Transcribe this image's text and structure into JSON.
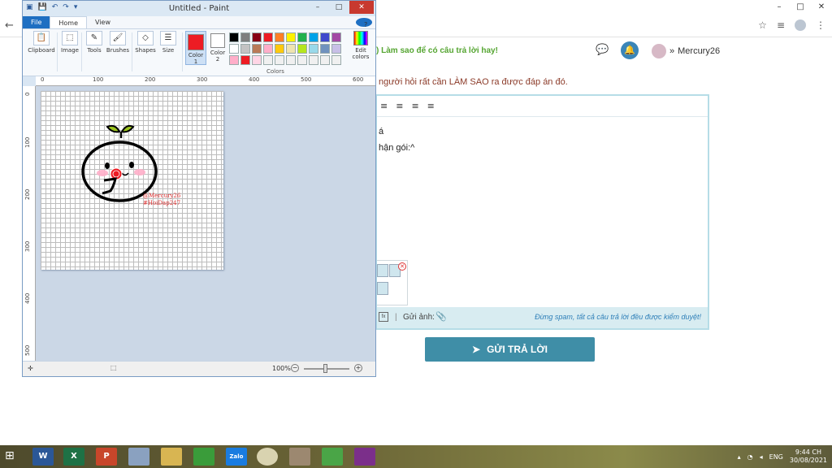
{
  "browser": {
    "window_controls": [
      "–",
      "□",
      "✕"
    ],
    "back_glyph": "←"
  },
  "site": {
    "promo": ") Làm sao để có câu trả lời hay!",
    "username": "Mercury26",
    "hint": "người hỏi rất cần LÀM SAO ra được đáp án đó.",
    "editor_line1": "á",
    "editor_line2": "hận gói:^",
    "attach_label": "Gửi ảnh:",
    "note": "Đừng spam, tất cả câu trả lời đều được kiểm duyệt!",
    "submit_label": "GỬI TRẢ LỜI"
  },
  "paint": {
    "title": "Untitled - Paint",
    "tabs": [
      "File",
      "Home",
      "View"
    ],
    "groups": {
      "clipboard": "Clipboard",
      "image": "Image",
      "tools": "Tools",
      "brushes": "Brushes",
      "shapes": "Shapes",
      "size": "Size",
      "color1": "Color 1",
      "color2": "Color 2",
      "colors": "Colors",
      "edit_colors": "Edit colors"
    },
    "palette": [
      "#000000",
      "#7f7f7f",
      "#880015",
      "#ed1c24",
      "#ff7f27",
      "#fff200",
      "#22b14c",
      "#00a2e8",
      "#3f48cc",
      "#a349a4",
      "#ffffff",
      "#c3c3c3",
      "#b97a57",
      "#ffaec9",
      "#ffc90e",
      "#efe4b0",
      "#b5e61d",
      "#99d9ea",
      "#7092be",
      "#c8bfe7",
      "#ffaec9",
      "#ed1c24",
      "#ffd5e5",
      "#f0f0f0",
      "#f0f0f0",
      "#f0f0f0",
      "#f0f0f0",
      "#f0f0f0",
      "#f0f0f0",
      "#f0f0f0"
    ],
    "ruler_h": [
      "0",
      "100",
      "200",
      "300",
      "400",
      "500",
      "600"
    ],
    "ruler_v": [
      "0",
      "100",
      "200",
      "300",
      "400",
      "500"
    ],
    "watermark_line1": "@Mercury26",
    "watermark_line2": "#HoiDap247",
    "zoom": "100%",
    "zoom_minus": "−",
    "zoom_plus": "+"
  },
  "taskbar": {
    "apps": [
      "W",
      "X",
      "P",
      "",
      "",
      "",
      "Zalo",
      "",
      "",
      "",
      ""
    ],
    "lang": "ENG",
    "time": "9:44 CH",
    "date": "30/08/2021"
  }
}
